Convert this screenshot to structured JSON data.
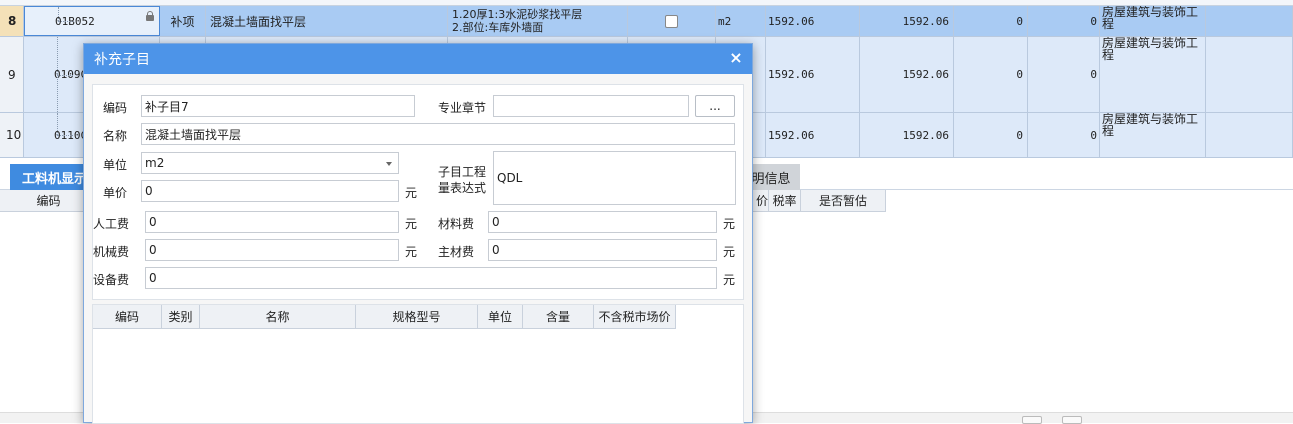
{
  "grid": {
    "rows": [
      {
        "num": "8",
        "code": "01B052",
        "type": "补项",
        "name": "混凝土墙面找平层",
        "feature_1": "1.20厚1:3水泥砂浆找平层",
        "feature_2": "2.部位:车库外墙面",
        "unit": "m2",
        "qty": "1592.06",
        "v1": "1592.06",
        "v2": "0",
        "v3": "0",
        "major": "房屋建筑与装饰工程"
      },
      {
        "num": "9",
        "code": "0109C",
        "qty": "1592.06",
        "v1": "1592.06",
        "v2": "0",
        "v3": "0",
        "major": "房屋建筑与装饰工程"
      },
      {
        "num": "10",
        "code": "0110C",
        "qty": "1592.06",
        "v1": "1592.06",
        "v2": "0",
        "v3": "0",
        "major": "房屋建筑与装饰工程"
      }
    ]
  },
  "bottom": {
    "tab_active": "工料机显示",
    "tab_right": "明信息",
    "header_left": "编码",
    "header_right": [
      "价",
      "税率",
      "是否暂估"
    ]
  },
  "dialog": {
    "title": "补充子目",
    "close": "×",
    "form": {
      "code_label": "编码",
      "code_value": "补子目7",
      "chapter_label": "专业章节",
      "chapter_value": "",
      "more_button": "...",
      "name_label": "名称",
      "name_value": "混凝土墙面找平层",
      "unit_label": "单位",
      "unit_value": "m2",
      "expr_label_1": "子目工程",
      "expr_label_2": "量表达式",
      "expr_value": "QDL",
      "price_label": "单价",
      "price_value": "0",
      "labor_label": "人工费",
      "labor_value": "0",
      "material_label": "材料费",
      "material_value": "0",
      "machine_label": "机械费",
      "machine_value": "0",
      "main_material_label": "主材费",
      "main_material_value": "0",
      "equipment_label": "设备费",
      "equipment_value": "0",
      "yuan": "元"
    },
    "sub_table": {
      "headers": [
        "编码",
        "类别",
        "名称",
        "规格型号",
        "单位",
        "含量",
        "不含税市场价"
      ]
    }
  }
}
